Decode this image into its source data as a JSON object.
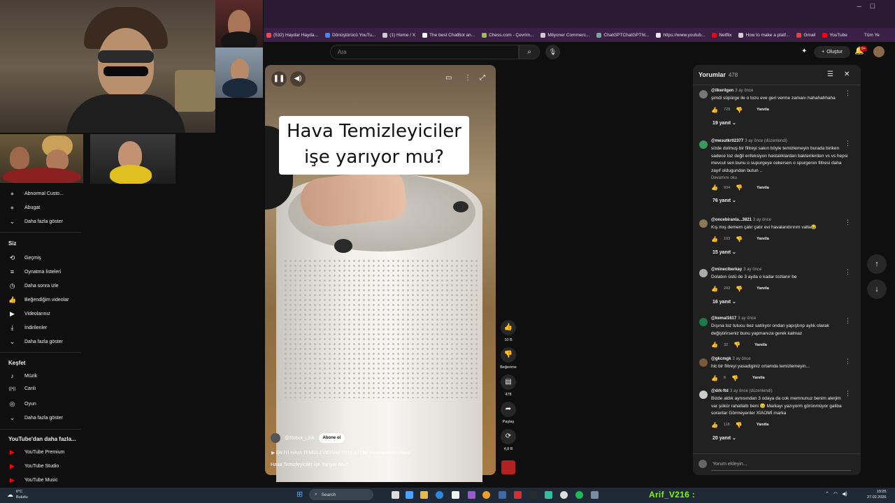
{
  "browser": {
    "bookmarks": [
      "(532) Haydar Hayda...",
      "Dönüştürücü YouTu...",
      "(1) Home / X",
      "The best ChatBot an...",
      "Chess.com - Çevrim...",
      "Milyoner Commerc...",
      "ChatGPTChatGPTht...",
      "https://www.youtub...",
      "Netflix",
      "How to make a platf...",
      "Gmail",
      "YouTube"
    ],
    "other_bookmarks": "Tüm Ye"
  },
  "topbar": {
    "search_placeholder": "Ara",
    "create_label": "Oluştur",
    "notif_badge": "9+"
  },
  "sidebar": {
    "subscriptions": [
      {
        "label": "Abnormal Custo...",
        "icon": "channel-avatar"
      },
      {
        "label": "Abugat",
        "icon": "channel-avatar"
      },
      {
        "label": "Daha fazla göster",
        "icon": "chevron-down-icon"
      }
    ],
    "you_heading": "Siz",
    "you_items": [
      {
        "label": "Geçmiş",
        "icon": "history-icon"
      },
      {
        "label": "Oynatma listeleri",
        "icon": "playlist-icon"
      },
      {
        "label": "Daha sonra izle",
        "icon": "clock-icon"
      },
      {
        "label": "Beğendiğim videolar",
        "icon": "thumbs-up-icon"
      },
      {
        "label": "Videolarınız",
        "icon": "video-icon"
      },
      {
        "label": "İndirilenler",
        "icon": "download-icon"
      },
      {
        "label": "Daha fazla göster",
        "icon": "chevron-down-icon"
      }
    ],
    "explore_heading": "Keşfet",
    "explore_items": [
      {
        "label": "Müzik",
        "icon": "music-icon"
      },
      {
        "label": "Canlı",
        "icon": "live-icon"
      },
      {
        "label": "Oyun",
        "icon": "gaming-icon"
      },
      {
        "label": "Daha fazla göster",
        "icon": "chevron-down-icon"
      }
    ],
    "more_heading": "YouTube'dan daha fazla...",
    "more_items": [
      {
        "label": "YouTube Premium",
        "icon": "youtube-icon"
      },
      {
        "label": "YouTube Studio",
        "icon": "youtube-icon"
      },
      {
        "label": "YouTube Music",
        "icon": "youtube-icon"
      }
    ]
  },
  "video": {
    "caption": "Hava Temizleyiciler işe yarıyor mu?",
    "channel": "@Robot_Link",
    "subscribe_label": "Abone ol",
    "music": "EN İYİ HAVA TEMİZLEYİCİSİNİ TEST ETTİM Dreame PM20 Hava ...",
    "title": "Hava Temizleyiciler İşe Yarıyor Mu?"
  },
  "actions": {
    "likes": "10 B",
    "dislike_label": "Beğenme",
    "comments": "478",
    "share_label": "Paylaş",
    "remix": "4,8 B"
  },
  "comments_panel": {
    "title": "Yorumlar",
    "count": "478",
    "input_placeholder": "Yorum ekleyin...",
    "reply_label": "Yanıtla",
    "items": [
      {
        "user": "@ilkerilgen",
        "time": "3 ay önce",
        "text": "şimdi süpürge ile o tozu eve geri verme zamanı hahahahhaha",
        "more": "",
        "likes": "728",
        "replies": "19 yanıt"
      },
      {
        "user": "@mesutkrtl2377",
        "time": "3 ay önce (düzenlendi)",
        "text": "sizde dolmuş bir filtreyi sakın böyle temizlemeyin   burada biriken sadece toz değil    enfeksiyon hastalıklardan bakterilerden  vs vs  hepsi mevcut  sen bunu  o supurgeye cekersen  o spurgenın filtresi  daha zayıf oldugundan butun ..",
        "more": "Devamını oku",
        "likes": "934",
        "replies": "76 yanıt"
      },
      {
        "user": "@oncebiranla...3821",
        "time": "3 ay önce",
        "text": "Kış mış demem çatır çatır evi havalandırırım valla😂",
        "more": "",
        "likes": "193",
        "replies": "15 yanıt"
      },
      {
        "user": "@mineciberkay",
        "time": "3 ay önce",
        "text": "Dolabın üstü de 3 ayda o kadar tozlanır be",
        "more": "",
        "likes": "243",
        "replies": "16 yanıt"
      },
      {
        "user": "@kemal1617",
        "time": "3 ay önce",
        "text": "Dışına toz tutucu bez satılıyor ondan yapıştırıp aylık olarak değiştirirseniz bunu yapmanıza gerek kalmaz",
        "more": "",
        "likes": "32",
        "replies": ""
      },
      {
        "user": "@gkcmgk",
        "time": "3 ay önce",
        "text": "hic bir filtreyi yasadiginiz ortamda temizlemeyin...",
        "more": "",
        "likes": "8",
        "replies": ""
      },
      {
        "user": "@drk-ftd",
        "time": "3 ay önce (düzenlendi)",
        "text": "Bizde aldık aynısından 3 odaya da cok memnunuz benim alerjim var şükür rahatlattı beni 😊 Markayı yazıyorm görünmüyor galiba soranlar Görmeyenler XİAOMİ marka",
        "more": "",
        "likes": "116",
        "replies": "20 yanıt"
      }
    ]
  },
  "taskbar": {
    "weather_temp": "6°C",
    "weather_desc": "Bulutlu",
    "search_label": "Search",
    "streamer_name": "Arif_V216 :",
    "time": "19:25",
    "date": "27.02.2026"
  },
  "colors": {
    "page_bg": "#0f0f0f",
    "panel_bg": "#212121",
    "browser_bg": "#2b1a34",
    "accent_red": "#ff0000",
    "streamer_green": "#7CFC00"
  }
}
